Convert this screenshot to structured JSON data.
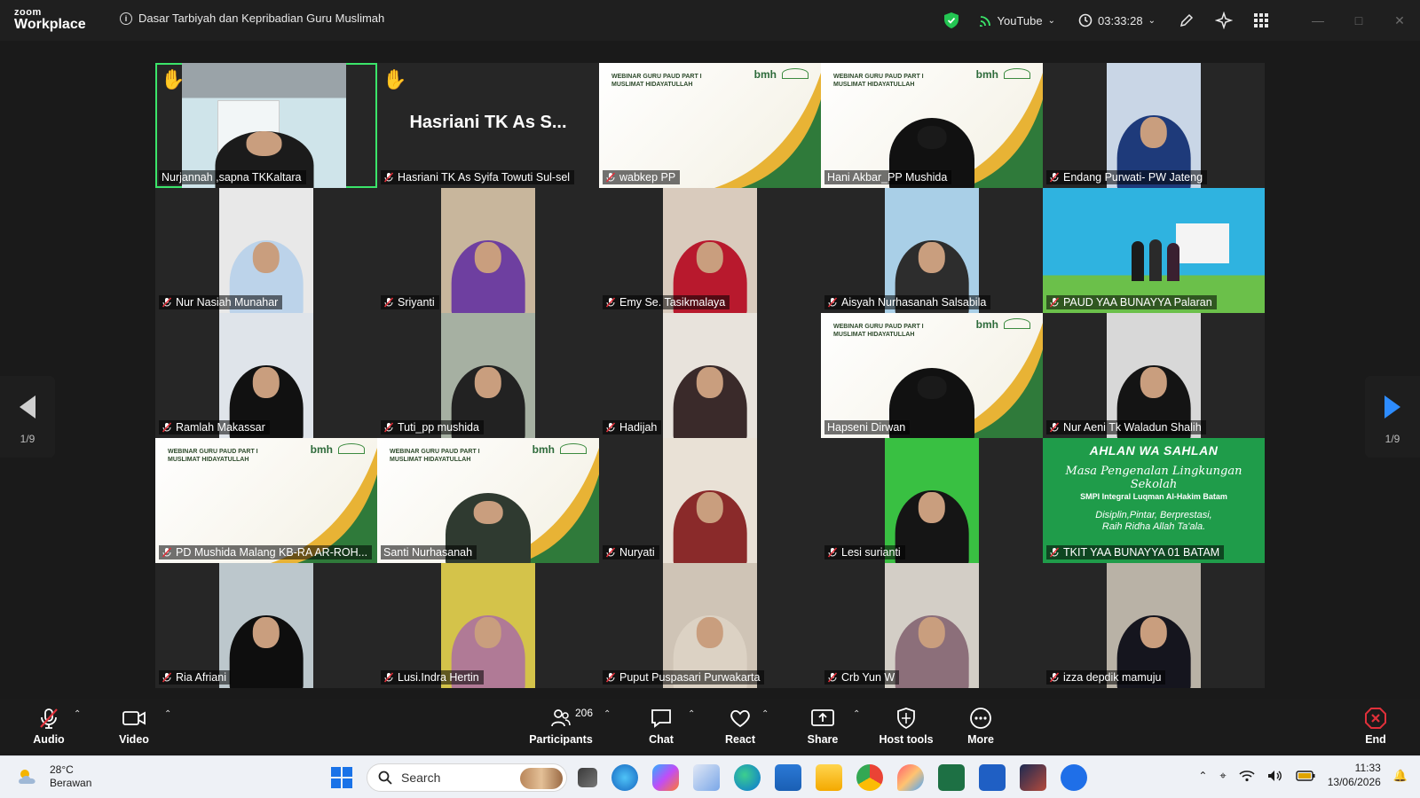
{
  "app": {
    "brand_top": "zoom",
    "brand_bottom": "Workplace",
    "meeting_title": "Dasar Tarbiyah dan Kepribadian Guru Muslimah",
    "stream_label": "YouTube",
    "elapsed": "03:33:28",
    "accent_green": "#3be56a",
    "accent_blue": "#2d8cff"
  },
  "gallery": {
    "page_left": "1/9",
    "page_right": "1/9",
    "raised_hand_name": "Hasriani TK As S...",
    "banner_text_line1": "WEBINAR GURU PAUD PART I",
    "banner_text_line2": "MUSLIMAT HIDAYATULLAH",
    "banner_logo": "bmh",
    "green_banner": {
      "line1": "AHLAN WA SAHLAN",
      "line2": "Masa Pengenalan Lingkungan Sekolah",
      "line3": "SMPI Integral Luqman Al-Hakim Batam",
      "line4": "Disiplin,Pintar, Berprestasi,",
      "line5": "Raih Ridha Allah Ta'ala."
    },
    "participants": [
      {
        "name": "Nurjannah ,sapna TKKaltara",
        "muted": false,
        "kind": "room",
        "hand": true,
        "active": true
      },
      {
        "name": "Hasriani TK As Syifa Towuti Sul-sel",
        "muted": true,
        "kind": "noVideo",
        "hand": true
      },
      {
        "name": "wabkep PP",
        "muted": true,
        "kind": "banner"
      },
      {
        "name": "Hani Akbar_PP Mushida",
        "muted": false,
        "kind": "bannerPerson"
      },
      {
        "name": "Endang Purwati- PW Jateng",
        "muted": true,
        "kind": "person",
        "scarf": "#1e3a7a",
        "bg": "#c9d6e6"
      },
      {
        "name": "Nur Nasiah Munahar",
        "muted": true,
        "kind": "person",
        "scarf": "#bcd3ea",
        "bg": "#e8e8e8"
      },
      {
        "name": "Sriyanti",
        "muted": true,
        "kind": "person",
        "scarf": "#6e3fa0",
        "bg": "#c8b69c"
      },
      {
        "name": "Emy Se. Tasikmalaya",
        "muted": true,
        "kind": "person",
        "scarf": "#b8192d",
        "bg": "#d9cbbd"
      },
      {
        "name": "Aisyah Nurhasanah Salsabila",
        "muted": true,
        "kind": "person",
        "scarf": "#2d2d2d",
        "bg": "#a9cfe7"
      },
      {
        "name": "PAUD YAA BUNAYYA Palaran",
        "muted": true,
        "kind": "classroom"
      },
      {
        "name": "Ramlah Makassar",
        "muted": true,
        "kind": "person",
        "scarf": "#111111",
        "bg": "#dfe4ea"
      },
      {
        "name": "Tuti_pp mushida",
        "muted": true,
        "kind": "person",
        "scarf": "#222222",
        "bg": "#a6b0a2"
      },
      {
        "name": "Hadijah",
        "muted": true,
        "kind": "person",
        "scarf": "#3a2a2a",
        "bg": "#e8e3dc"
      },
      {
        "name": "Hapseni Dirwan",
        "muted": false,
        "kind": "bannerPersonDark"
      },
      {
        "name": "Nur Aeni Tk Waladun Shalih",
        "muted": true,
        "kind": "person",
        "scarf": "#141414",
        "bg": "#d8d8d8"
      },
      {
        "name": "PD Mushida Malang KB-RA AR-ROH...",
        "muted": true,
        "kind": "banner"
      },
      {
        "name": "Santi Nurhasanah",
        "muted": false,
        "kind": "bannerPersonGreen"
      },
      {
        "name": "Nuryati",
        "muted": true,
        "kind": "person",
        "scarf": "#8a2a2a",
        "bg": "#e9e1d6"
      },
      {
        "name": "Lesi surianti",
        "muted": true,
        "kind": "person",
        "scarf": "#151515",
        "bg": "#39c042"
      },
      {
        "name": "TKIT YAA BUNAYYA 01 BATAM",
        "muted": true,
        "kind": "greenBanner"
      },
      {
        "name": "Ria Afriani",
        "muted": true,
        "kind": "person",
        "scarf": "#0e0e0e",
        "bg": "#bcc7cc"
      },
      {
        "name": "Lusi.Indra Hertin",
        "muted": true,
        "kind": "person",
        "scarf": "#b07a96",
        "bg": "#d4c34a"
      },
      {
        "name": "Puput Puspasari Purwakarta",
        "muted": true,
        "kind": "person",
        "scarf": "#dcd2c4",
        "bg": "#cfc4b6"
      },
      {
        "name": "Crb Yun W",
        "muted": true,
        "kind": "person",
        "scarf": "#8c6f7a",
        "bg": "#d3cec6"
      },
      {
        "name": "izza depdik mamuju",
        "muted": true,
        "kind": "person",
        "scarf": "#15151e",
        "bg": "#b9b2a6"
      }
    ]
  },
  "toolbar": {
    "audio": "Audio",
    "video": "Video",
    "participants": "Participants",
    "participants_count": "206",
    "chat": "Chat",
    "react": "React",
    "share": "Share",
    "host_tools": "Host tools",
    "more": "More",
    "end": "End"
  },
  "taskbar": {
    "temp": "28°C",
    "weather": "Berawan",
    "search": "Search",
    "time": "11:33",
    "date": "13/06/2026"
  }
}
